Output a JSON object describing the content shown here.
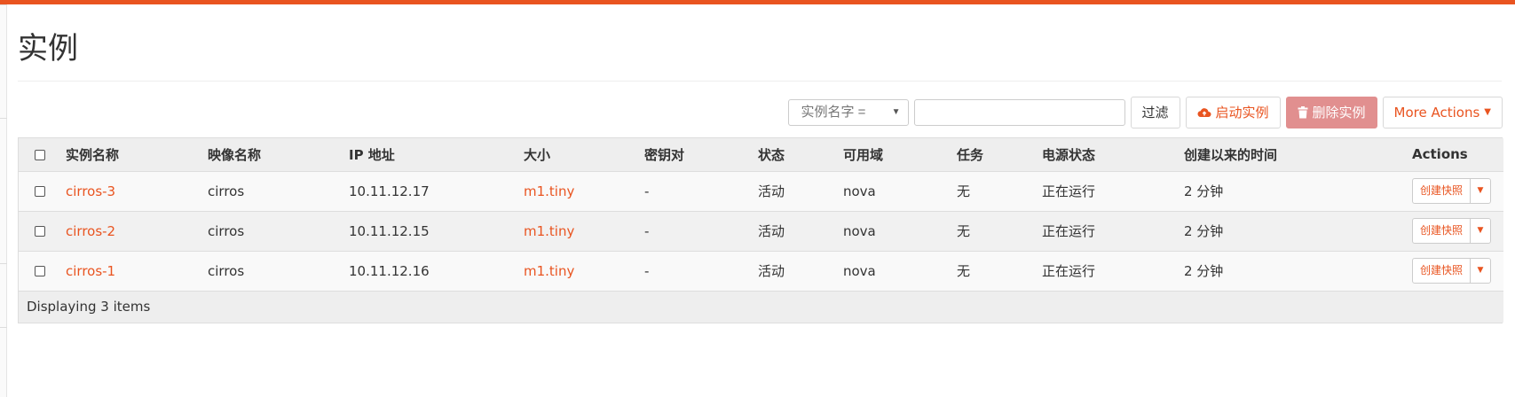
{
  "page": {
    "title": "实例"
  },
  "toolbar": {
    "filter_select": "实例名字 =",
    "filter_input_value": "",
    "filter_button": "过滤",
    "launch_button": "启动实例",
    "delete_button": "删除实例",
    "more_button": "More Actions"
  },
  "table": {
    "headers": {
      "name": "实例名称",
      "image": "映像名称",
      "ip": "IP 地址",
      "size": "大小",
      "keypair": "密钥对",
      "status": "状态",
      "az": "可用域",
      "task": "任务",
      "power": "电源状态",
      "age": "创建以来的时间",
      "actions": "Actions"
    },
    "rows": [
      {
        "name": "cirros-3",
        "image": "cirros",
        "ip": "10.11.12.17",
        "size": "m1.tiny",
        "keypair": "-",
        "status": "活动",
        "az": "nova",
        "task": "无",
        "power": "正在运行",
        "age": "2 分钟",
        "action": "创建快照"
      },
      {
        "name": "cirros-2",
        "image": "cirros",
        "ip": "10.11.12.15",
        "size": "m1.tiny",
        "keypair": "-",
        "status": "活动",
        "az": "nova",
        "task": "无",
        "power": "正在运行",
        "age": "2 分钟",
        "action": "创建快照"
      },
      {
        "name": "cirros-1",
        "image": "cirros",
        "ip": "10.11.12.16",
        "size": "m1.tiny",
        "keypair": "-",
        "status": "活动",
        "az": "nova",
        "task": "无",
        "power": "正在运行",
        "age": "2 分钟",
        "action": "创建快照"
      }
    ],
    "footer": "Displaying 3 items"
  },
  "colors": {
    "accent": "#e95420",
    "danger": "#e18f8f"
  }
}
